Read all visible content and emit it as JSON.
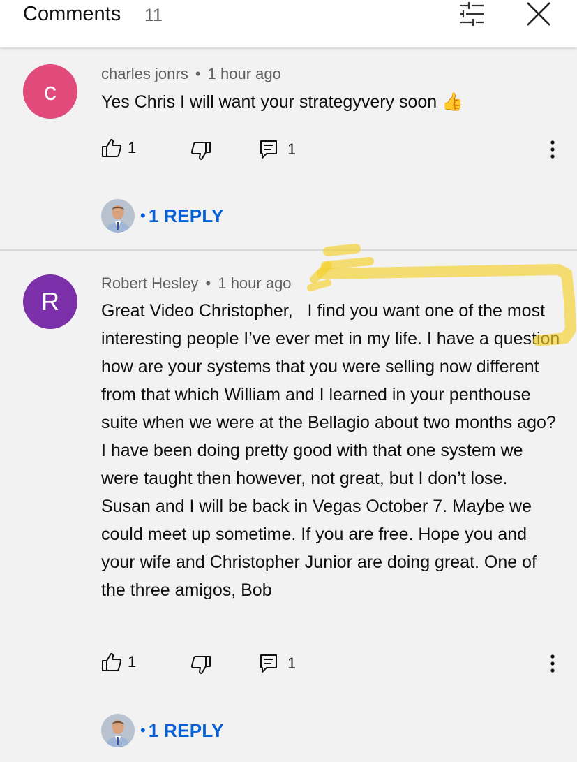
{
  "header": {
    "title": "Comments",
    "count": "11",
    "filter_icon": "sliders-icon",
    "close_icon": "close-icon"
  },
  "comments": [
    {
      "avatar_letter": "c",
      "avatar_color": "#e04b7c",
      "author": "charles jonrs",
      "time": "1 hour ago",
      "text": "Yes Chris I will want your strategyvery soon 👍",
      "likes": "1",
      "replies_count": "1",
      "reply_label": "1 REPLY"
    },
    {
      "avatar_letter": "R",
      "avatar_color": "#7b2fa8",
      "author": "Robert Hesley",
      "time": "1 hour ago",
      "text": "Great Video Christopher,   I find you want one of the most interesting people I’ve ever met in my life. I have a question how are your systems that you were selling now different from that which William and I learned in your penthouse suite when we were at the Bellagio about two months ago? I have been doing pretty good with that one system we were taught then however, not great, but I don’t lose. Susan and I will be back in Vegas October 7. Maybe we could meet up sometime. If you are free. Hope you and your wife and Christopher Junior are doing great. One of the three amigos, Bob",
      "likes": "1",
      "replies_count": "1",
      "reply_label": "1 REPLY"
    }
  ],
  "separator": "•",
  "icons": {
    "like": "thumbs-up-icon",
    "dislike": "thumbs-down-icon",
    "reply": "reply-icon",
    "more": "more-vert-icon"
  },
  "colors": {
    "link": "#065fd4",
    "highlight": "#f5d02a"
  }
}
